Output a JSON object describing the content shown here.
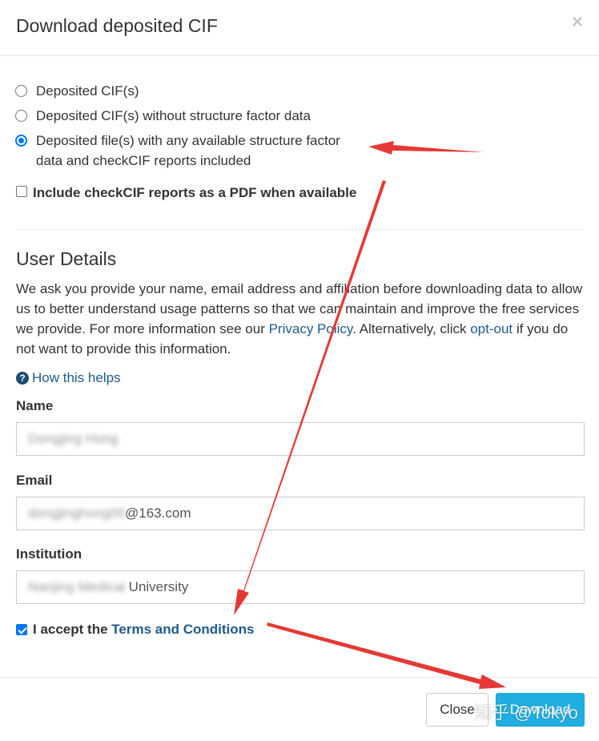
{
  "modal": {
    "title": "Download deposited CIF",
    "close_glyph": "×"
  },
  "download_options": [
    {
      "label": "Deposited CIF(s)",
      "checked": false
    },
    {
      "label": "Deposited CIF(s) without structure factor data",
      "checked": false
    },
    {
      "label_line1": "Deposited file(s) with any available structure factor",
      "label_line2": "data and checkCIF reports included",
      "checked": true
    }
  ],
  "checkcif_pdf": {
    "label": "Include checkCIF reports as a PDF when available",
    "checked": false
  },
  "user_details": {
    "title": "User Details",
    "intro_part1": "We ask you provide your name, email address and affiliation before downloading data to allow us to better understand usage patterns so that we can maintain and improve the free services we provide. For more information see our ",
    "privacy_link": "Privacy Policy",
    "intro_part2": ". Alternatively, click ",
    "optout_link": "opt-out",
    "intro_part3": " if you do not want to provide this information.",
    "help_icon": "question-circle-icon",
    "help_link": "How this helps"
  },
  "form": {
    "name_label": "Name",
    "name_value": "Dongjing Hong",
    "email_label": "Email",
    "email_prefix": "dongjinghong00",
    "email_suffix": "@163.com",
    "institution_label": "Institution",
    "institution_prefix": "Nanjing Medical",
    "institution_suffix": " University"
  },
  "terms": {
    "prefix": "I accept the ",
    "link": "Terms and Conditions",
    "checked": true
  },
  "buttons": {
    "close": "Close",
    "download": "Download"
  },
  "watermark": "知乎 @Tokyo",
  "colors": {
    "accent_link": "#1f5a8a",
    "download_button": "#20aee0",
    "annotation_arrow": "#e53935",
    "checkbox_blue": "#0075ff"
  }
}
